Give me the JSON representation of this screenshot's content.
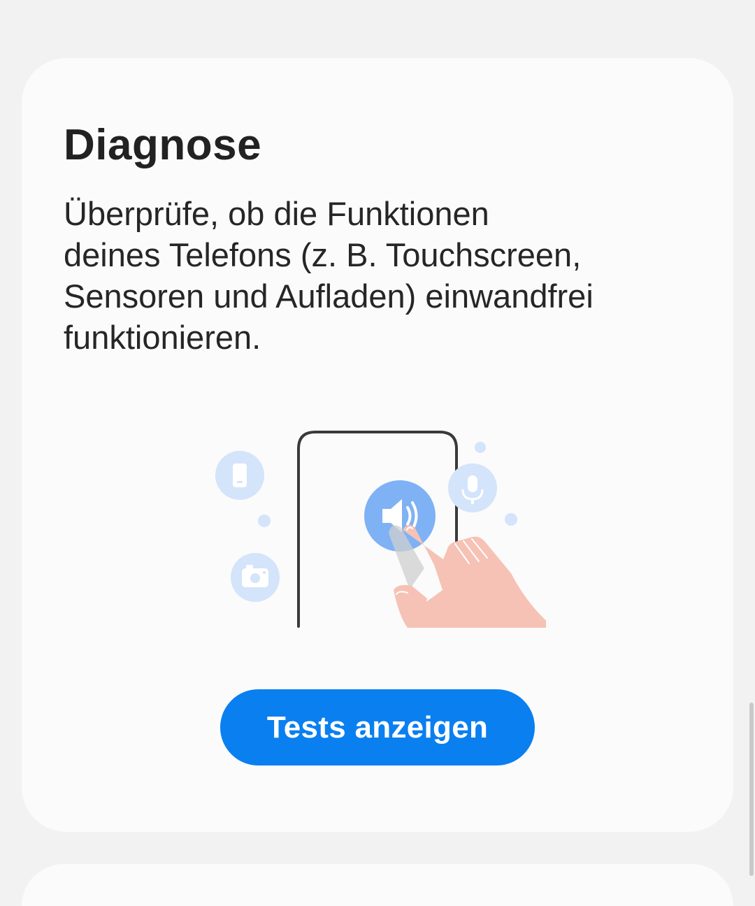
{
  "card": {
    "title": "Diagnose",
    "description": "Überprüfe, ob die Funktionen\ndeines Telefons (z. B. Touchscreen,\nSensoren und Aufladen) einwandfrei\nfunktionieren.",
    "button_label": "Tests anzeigen"
  },
  "illustration": {
    "icons": [
      "phone-icon",
      "camera-icon",
      "speaker-icon",
      "microphone-icon",
      "hand-icon"
    ]
  },
  "colors": {
    "background": "#f2f2f2",
    "card": "#fbfbfb",
    "accent": "#0a7ff0",
    "icon_bubble": "#d3e4fb",
    "speaker_bubble": "#7fb2f4",
    "hand": "#f6c2b6"
  }
}
